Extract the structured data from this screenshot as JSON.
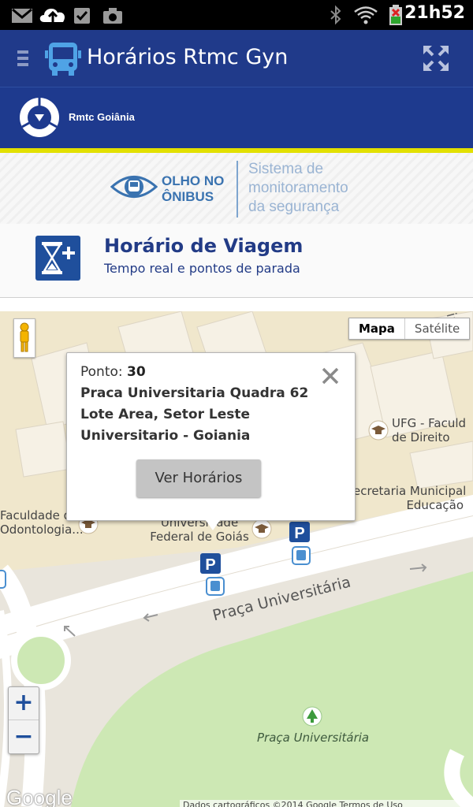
{
  "status_bar": {
    "time": "21h52",
    "icons": [
      "gmail-icon",
      "upload-icon",
      "task-icon",
      "camera-icon",
      "bluetooth-icon",
      "wifi-icon",
      "battery-icon"
    ]
  },
  "app_bar": {
    "title": "Horários Rtmc Gyn",
    "color": "#203a8a"
  },
  "brand": {
    "name": "Rmtc Goiânia",
    "stripe_color": "#e2e000"
  },
  "banner": {
    "logo_text_line1": "OLHO NO",
    "logo_text_line2": "ÔNIBUS",
    "tagline": "Sistema de\nmonitoramento\nda segurança"
  },
  "section": {
    "title": "Horário de Viagem",
    "subtitle": "Tempo real e pontos de parada"
  },
  "map": {
    "type_options": [
      "Mapa",
      "Satélite"
    ],
    "selected_type": "Mapa",
    "labels": {
      "ufg_line1": "UFG - Faculd",
      "ufg_line2": "de Direito",
      "secretaria_line1": "ecretaria Municipal",
      "secretaria_line2": "Educação",
      "odonto_line1": "Faculdade d",
      "odonto_line2": "Odontologia...",
      "universidade_line1": "Universidade",
      "universidade_line2": "Federal de Goiás",
      "street": "Praça Universitária",
      "park": "Praça Universitária",
      "street_edge": "ia"
    },
    "zoom_in": "+",
    "zoom_out": "−",
    "google": "Google",
    "attribution": "Dados cartográficos ©2014 Google   Termos de Uso"
  },
  "info_window": {
    "ponto_label": "Ponto:",
    "ponto_number": "30",
    "address": "Praca Universitaria Quadra 62 Lote Area, Setor Leste Universitario - Goiania",
    "button": "Ver Horários"
  }
}
